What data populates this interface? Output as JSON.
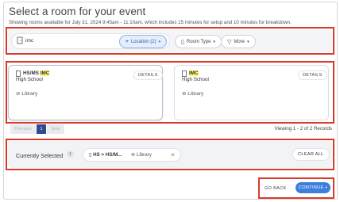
{
  "header": {
    "title": "Select a room for your event",
    "subtitle": "Showing rooms available for July 31, 2024 9:45am - 11:10am, which includes 15 minutes for setup and 10 minutes for breakdown."
  },
  "search": {
    "value": "imc",
    "filters": [
      {
        "label": "Location (2)",
        "icon": "pin-icon",
        "active": true
      },
      {
        "label": "Room Type",
        "icon": "room-icon",
        "active": false
      },
      {
        "label": "More",
        "icon": "filter-icon",
        "active": false
      }
    ]
  },
  "rooms": [
    {
      "title_prefix": "HS/MS ",
      "title_highlight": "IMC",
      "subtitle": "High School",
      "location": "Library",
      "details_label": "DETAILS",
      "selected": true
    },
    {
      "title_prefix": "",
      "title_highlight": "IMC",
      "subtitle": "High School",
      "location": "Library",
      "details_label": "DETAILS",
      "selected": false
    }
  ],
  "pagination": {
    "prev_label": "Previous",
    "current_page": "1",
    "next_label": "Next",
    "viewing_text": "Viewing 1 - 2 of 2 Records"
  },
  "selection": {
    "label": "Currently Selected",
    "count": "1",
    "chip_name": "HS > HS/M...",
    "chip_location": "Library",
    "clear_label": "CLEAR ALL"
  },
  "footer": {
    "back_label": "GO BACK",
    "continue_label": "CONTINUE"
  },
  "colors": {
    "highlight_box": "#d93b2b",
    "primary": "#3f7fdc",
    "page_active": "#2d4b8e",
    "match_highlight": "#fff36b"
  }
}
